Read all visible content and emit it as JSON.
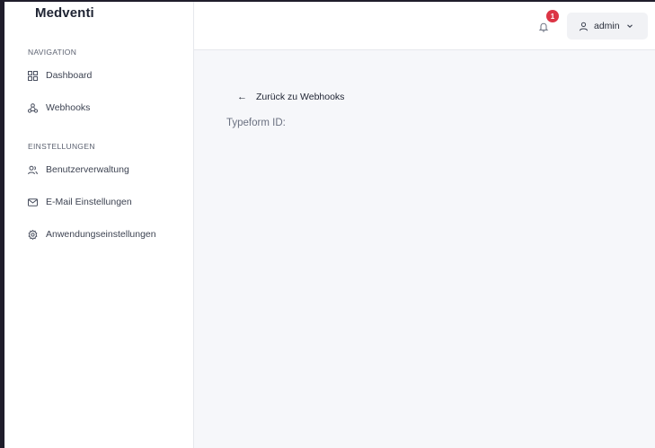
{
  "brand": "Medventi",
  "sidebar": {
    "sections": [
      {
        "label": "NAVIGATION",
        "items": [
          {
            "label": "Dashboard",
            "icon": "dashboard-icon"
          },
          {
            "label": "Webhooks",
            "icon": "webhook-icon"
          }
        ]
      },
      {
        "label": "EINSTELLUNGEN",
        "items": [
          {
            "label": "Benutzerverwaltung",
            "icon": "users-icon"
          },
          {
            "label": "E-Mail Einstellungen",
            "icon": "mail-icon"
          },
          {
            "label": "Anwendungseinstellungen",
            "icon": "gear-icon"
          }
        ]
      }
    ]
  },
  "header": {
    "notification_count": "1",
    "user_name": "admin"
  },
  "main": {
    "back_label": "Zurück zu Webhooks",
    "back_arrow": "←",
    "field_label": "Typeform ID:"
  },
  "colors": {
    "badge": "#dc3545",
    "page_bg": "#f6f7fa",
    "outer_bg": "#1f1d2b"
  }
}
